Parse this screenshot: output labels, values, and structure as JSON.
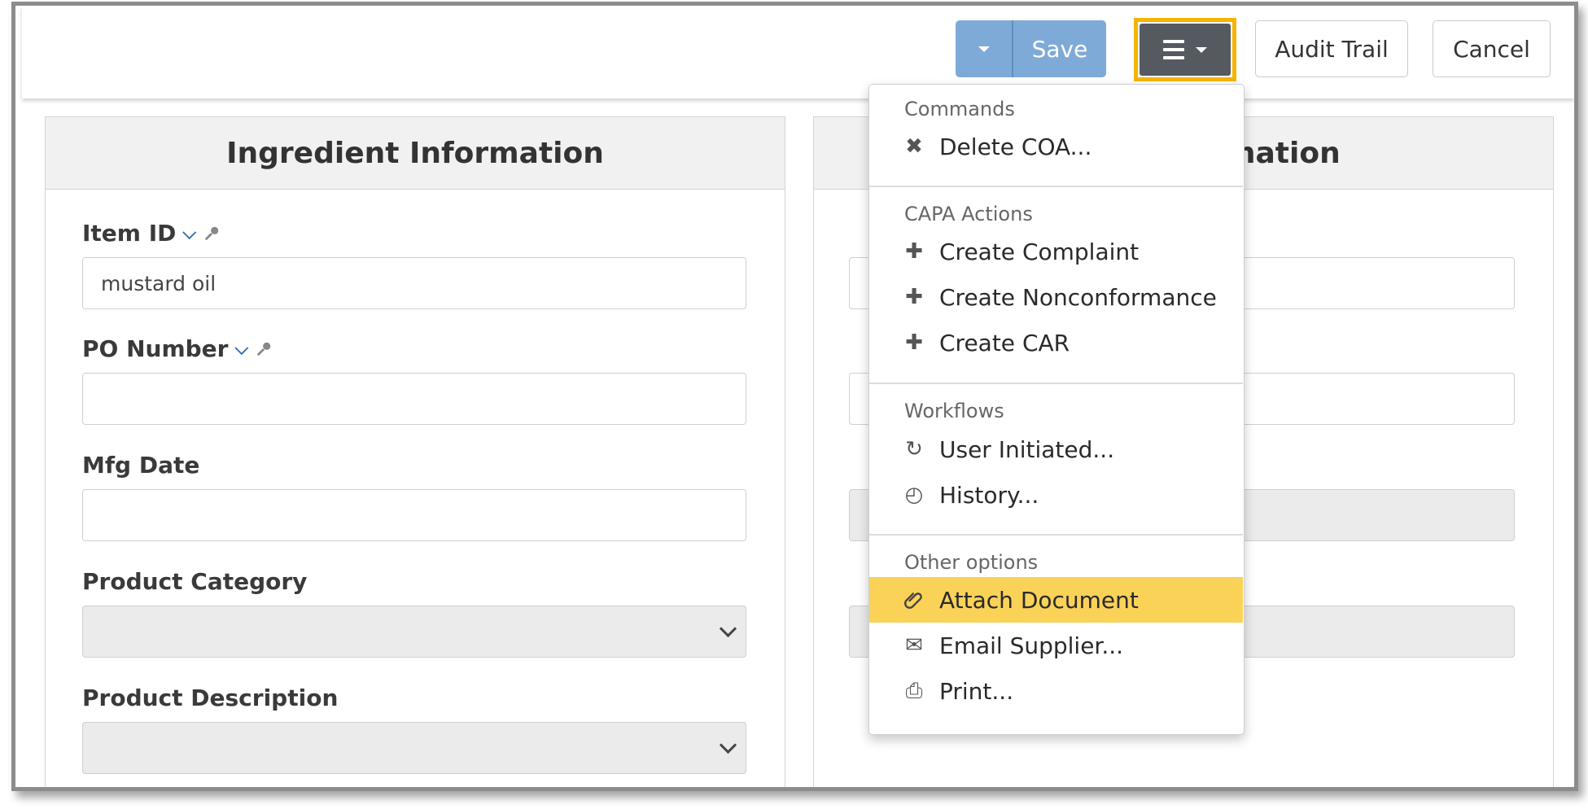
{
  "toolbar": {
    "save_label": "Save",
    "audit_label": "Audit Trail",
    "cancel_label": "Cancel"
  },
  "left_panel": {
    "title": "Ingredient Information",
    "fields": {
      "item_id_label": "Item ID",
      "item_id_value": "mustard oil",
      "po_number_label": "PO Number",
      "mfg_date_label": "Mfg Date",
      "product_category_label": "Product Category",
      "product_description_label": "Product Description"
    }
  },
  "right_panel": {
    "title_visible": "mation"
  },
  "menu": {
    "sections": [
      {
        "title": "Commands",
        "items": [
          {
            "label": "Delete COA...",
            "icon": "close-icon"
          }
        ]
      },
      {
        "title": "CAPA Actions",
        "items": [
          {
            "label": "Create Complaint",
            "icon": "plus-icon"
          },
          {
            "label": "Create Nonconformance",
            "icon": "plus-icon"
          },
          {
            "label": "Create CAR",
            "icon": "plus-icon"
          }
        ]
      },
      {
        "title": "Workflows",
        "items": [
          {
            "label": "User Initiated...",
            "icon": "refresh-icon"
          },
          {
            "label": "History...",
            "icon": "clock-icon"
          }
        ]
      },
      {
        "title": "Other options",
        "items": [
          {
            "label": "Attach Document",
            "icon": "paperclip-icon"
          },
          {
            "label": "Email Supplier...",
            "icon": "envelope-icon"
          },
          {
            "label": "Print...",
            "icon": "printer-icon"
          }
        ]
      }
    ],
    "active_item": "Attach Document"
  },
  "colors": {
    "save_button": "#7eaad7",
    "menu_button": "#555a60",
    "highlight_border": "#f6b400",
    "active_item": "#fbd258",
    "chevron_blue": "#2b6cb0"
  }
}
